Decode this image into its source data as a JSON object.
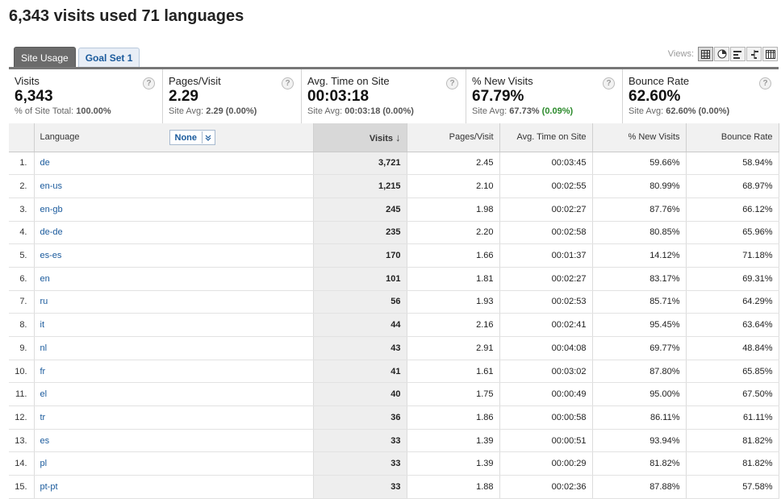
{
  "page": {
    "title": "6,343 visits used 71 languages"
  },
  "tabs": [
    {
      "label": "Site Usage",
      "active": true
    },
    {
      "label": "Goal Set 1",
      "active": false
    }
  ],
  "views": {
    "label": "Views:",
    "icons": [
      "table-view-icon",
      "pie-view-icon",
      "bar-view-icon",
      "comparison-view-icon",
      "pivot-view-icon"
    ]
  },
  "scorecards": [
    {
      "label": "Visits",
      "value": "6,343",
      "sub_prefix": "% of Site Total: ",
      "sub_value": "100.00%",
      "sub_delta": ""
    },
    {
      "label": "Pages/Visit",
      "value": "2.29",
      "sub_prefix": "Site Avg: ",
      "sub_value": "2.29 (0.00%)",
      "sub_delta": ""
    },
    {
      "label": "Avg. Time on Site",
      "value": "00:03:18",
      "sub_prefix": "Site Avg: ",
      "sub_value": "00:03:18 (0.00%)",
      "sub_delta": ""
    },
    {
      "label": "% New Visits",
      "value": "67.79%",
      "sub_prefix": "Site Avg: ",
      "sub_value": "67.73%",
      "sub_delta": "(0.09%)"
    },
    {
      "label": "Bounce Rate",
      "value": "62.60%",
      "sub_prefix": "Site Avg: ",
      "sub_value": "62.60% (0.00%)",
      "sub_delta": ""
    }
  ],
  "table": {
    "headers": {
      "language": "Language",
      "segment": "None",
      "visits": "Visits",
      "pages": "Pages/Visit",
      "time": "Avg. Time on Site",
      "new": "% New Visits",
      "bounce": "Bounce Rate"
    },
    "rows": [
      {
        "idx": "1.",
        "lang": "de",
        "visits": "3,721",
        "pages": "2.45",
        "time": "00:03:45",
        "new": "59.66%",
        "bounce": "58.94%"
      },
      {
        "idx": "2.",
        "lang": "en-us",
        "visits": "1,215",
        "pages": "2.10",
        "time": "00:02:55",
        "new": "80.99%",
        "bounce": "68.97%"
      },
      {
        "idx": "3.",
        "lang": "en-gb",
        "visits": "245",
        "pages": "1.98",
        "time": "00:02:27",
        "new": "87.76%",
        "bounce": "66.12%"
      },
      {
        "idx": "4.",
        "lang": "de-de",
        "visits": "235",
        "pages": "2.20",
        "time": "00:02:58",
        "new": "80.85%",
        "bounce": "65.96%"
      },
      {
        "idx": "5.",
        "lang": "es-es",
        "visits": "170",
        "pages": "1.66",
        "time": "00:01:37",
        "new": "14.12%",
        "bounce": "71.18%"
      },
      {
        "idx": "6.",
        "lang": "en",
        "visits": "101",
        "pages": "1.81",
        "time": "00:02:27",
        "new": "83.17%",
        "bounce": "69.31%"
      },
      {
        "idx": "7.",
        "lang": "ru",
        "visits": "56",
        "pages": "1.93",
        "time": "00:02:53",
        "new": "85.71%",
        "bounce": "64.29%"
      },
      {
        "idx": "8.",
        "lang": "it",
        "visits": "44",
        "pages": "2.16",
        "time": "00:02:41",
        "new": "95.45%",
        "bounce": "63.64%"
      },
      {
        "idx": "9.",
        "lang": "nl",
        "visits": "43",
        "pages": "2.91",
        "time": "00:04:08",
        "new": "69.77%",
        "bounce": "48.84%"
      },
      {
        "idx": "10.",
        "lang": "fr",
        "visits": "41",
        "pages": "1.61",
        "time": "00:03:02",
        "new": "87.80%",
        "bounce": "65.85%"
      },
      {
        "idx": "11.",
        "lang": "el",
        "visits": "40",
        "pages": "1.75",
        "time": "00:00:49",
        "new": "95.00%",
        "bounce": "67.50%"
      },
      {
        "idx": "12.",
        "lang": "tr",
        "visits": "36",
        "pages": "1.86",
        "time": "00:00:58",
        "new": "86.11%",
        "bounce": "61.11%"
      },
      {
        "idx": "13.",
        "lang": "es",
        "visits": "33",
        "pages": "1.39",
        "time": "00:00:51",
        "new": "93.94%",
        "bounce": "81.82%"
      },
      {
        "idx": "14.",
        "lang": "pl",
        "visits": "33",
        "pages": "1.39",
        "time": "00:00:29",
        "new": "81.82%",
        "bounce": "81.82%"
      },
      {
        "idx": "15.",
        "lang": "pt-pt",
        "visits": "33",
        "pages": "1.88",
        "time": "00:02:36",
        "new": "87.88%",
        "bounce": "57.58%"
      }
    ]
  }
}
